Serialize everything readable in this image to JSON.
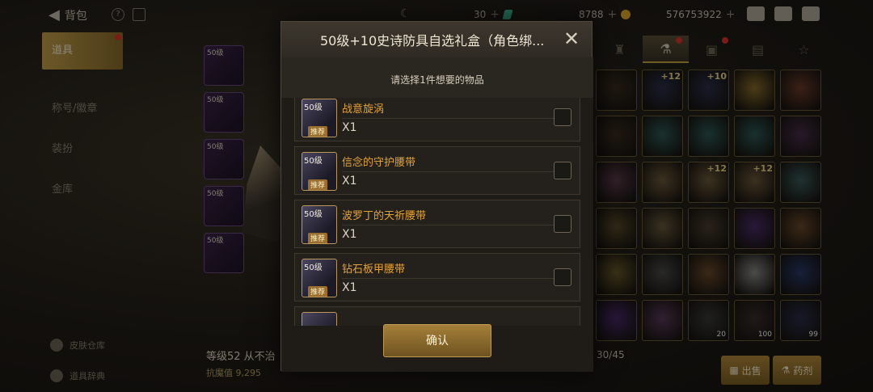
{
  "topbar": {
    "back_label": "背包",
    "help_icon_text": "?",
    "currencies": [
      {
        "value": "30",
        "icon": "gem-icon"
      },
      {
        "value": "8788",
        "icon": "coin-icon"
      },
      {
        "value": "576753922",
        "icon": "gold-icon"
      }
    ]
  },
  "leftnav": {
    "items": [
      {
        "label": "道具",
        "active": true
      },
      {
        "label": "称号/徽章"
      },
      {
        "label": "装扮"
      },
      {
        "label": "金库"
      }
    ],
    "bottom": [
      "皮肤仓库",
      "道具辞典"
    ]
  },
  "equip": {
    "slots": [
      "50级",
      "50级",
      "50级",
      "50级",
      "50级"
    ]
  },
  "character": {
    "name": "等级52 从不治",
    "power": "抗魔值 9,295"
  },
  "inventory": {
    "counter": "30/45",
    "cells": [
      {
        "color": "#3a2d1e",
        "tag": "",
        "cnt": ""
      },
      {
        "color": "#2b2f4a",
        "tag": "+12",
        "cnt": ""
      },
      {
        "color": "#2b2f4a",
        "tag": "+10",
        "cnt": ""
      },
      {
        "color": "#8a6d2a",
        "tag": "",
        "cnt": ""
      },
      {
        "color": "#6b3a2a",
        "tag": "",
        "cnt": ""
      },
      {
        "color": "#3a2d1e",
        "tag": "",
        "cnt": ""
      },
      {
        "color": "#2f5a55",
        "tag": "",
        "cnt": ""
      },
      {
        "color": "#2f5a55",
        "tag": "",
        "cnt": ""
      },
      {
        "color": "#2f5a55",
        "tag": "",
        "cnt": ""
      },
      {
        "color": "#4a2e4a",
        "tag": "",
        "cnt": ""
      },
      {
        "color": "#5a3a4a",
        "tag": "",
        "cnt": ""
      },
      {
        "color": "#6e5a3a",
        "tag": "",
        "cnt": ""
      },
      {
        "color": "#6e5a3a",
        "tag": "+12",
        "cnt": ""
      },
      {
        "color": "#6e5a3a",
        "tag": "+12",
        "cnt": ""
      },
      {
        "color": "#3a5a5a",
        "tag": "",
        "cnt": ""
      },
      {
        "color": "#5a4a2a",
        "tag": "",
        "cnt": ""
      },
      {
        "color": "#6a5a3a",
        "tag": "",
        "cnt": ""
      },
      {
        "color": "#4a3e2e",
        "tag": "",
        "cnt": ""
      },
      {
        "color": "#4a2e6a",
        "tag": "",
        "cnt": ""
      },
      {
        "color": "#6a4a2a",
        "tag": "",
        "cnt": ""
      },
      {
        "color": "#6a5a2a",
        "tag": "",
        "cnt": ""
      },
      {
        "color": "#4a4a4a",
        "tag": "",
        "cnt": ""
      },
      {
        "color": "#6a4a2a",
        "tag": "",
        "cnt": ""
      },
      {
        "color": "#8a8a8a",
        "tag": "",
        "cnt": ""
      },
      {
        "color": "#2a3a6a",
        "tag": "",
        "cnt": ""
      },
      {
        "color": "#4a2a6a",
        "tag": "",
        "cnt": ""
      },
      {
        "color": "#5a3a5a",
        "tag": "",
        "cnt": ""
      },
      {
        "color": "#3a3a3a",
        "tag": "",
        "cnt": "20"
      },
      {
        "color": "#3a2e2a",
        "tag": "",
        "cnt": "100"
      },
      {
        "color": "#2a2e4a",
        "tag": "",
        "cnt": "99"
      }
    ],
    "sell_label": "出售",
    "decompose_label": "药剂"
  },
  "modal": {
    "title": "50级+10史诗防具自选礼盒（角色绑...",
    "prompt": "请选择1件想要的物品",
    "items": [
      {
        "level": "50级",
        "recommend": "推荐",
        "name": "战意旋涡",
        "qty": "X1"
      },
      {
        "level": "50级",
        "recommend": "推荐",
        "name": "信念的守护腰带",
        "qty": "X1"
      },
      {
        "level": "50级",
        "recommend": "推荐",
        "name": "波罗丁的天祈腰带",
        "qty": "X1"
      },
      {
        "level": "50级",
        "recommend": "推荐",
        "name": "钻石板甲腰带",
        "qty": "X1"
      }
    ],
    "confirm_label": "确认"
  }
}
